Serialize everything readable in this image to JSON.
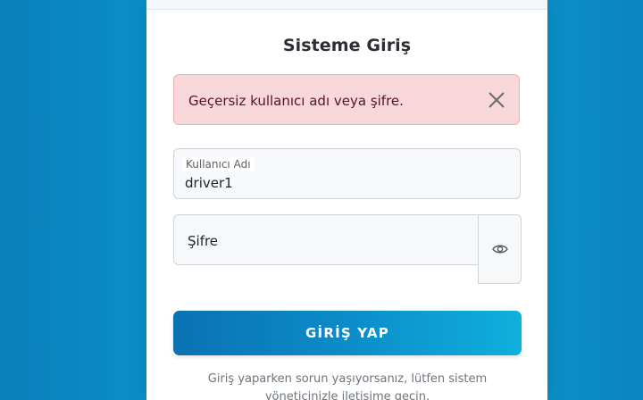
{
  "login": {
    "title": "Sisteme Giriş",
    "alert": {
      "message": "Geçersiz kullanıcı adı veya şifre.",
      "close_icon": "close-icon"
    },
    "username": {
      "label": "Kullanıcı Adı",
      "value": "driver1"
    },
    "password": {
      "label": "Şifre",
      "toggle_icon": "eye-icon"
    },
    "submit_label": "GİRİŞ YAP",
    "help_text": "Giriş yaparken sorun yaşıyorsanız, lütfen sistem yöneticinizle iletişime geçin."
  },
  "colors": {
    "background": "#0a95cc",
    "alert_bg": "#f8d7da",
    "alert_text": "#58151c",
    "button_start": "#0a72b3",
    "button_end": "#0fb0dc"
  }
}
